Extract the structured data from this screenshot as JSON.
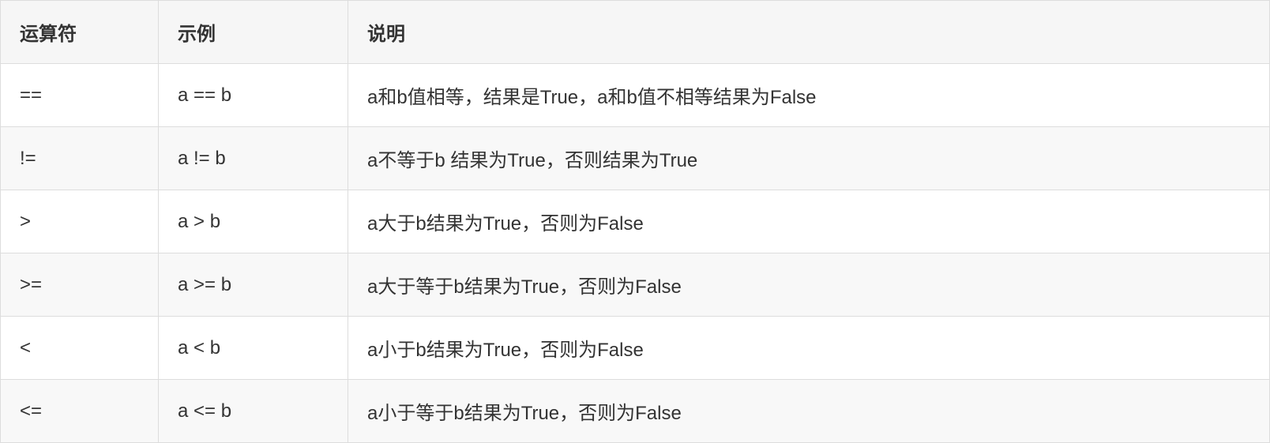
{
  "table": {
    "headers": {
      "operator": "运算符",
      "example": "示例",
      "description": "说明"
    },
    "rows": [
      {
        "operator": "==",
        "example": "a == b",
        "description": "a和b值相等，结果是True，a和b值不相等结果为False"
      },
      {
        "operator": "!=",
        "example": "a != b",
        "description": "a不等于b 结果为True，否则结果为True"
      },
      {
        "operator": ">",
        "example": "a  > b",
        "description": "a大于b结果为True，否则为False"
      },
      {
        "operator": ">=",
        "example": "a  >=  b",
        "description": "a大于等于b结果为True，否则为False"
      },
      {
        "operator": "<",
        "example": "a < b",
        "description": "a小于b结果为True，否则为False"
      },
      {
        "operator": "<=",
        "example": "a <= b",
        "description": "a小于等于b结果为True，否则为False"
      }
    ]
  }
}
